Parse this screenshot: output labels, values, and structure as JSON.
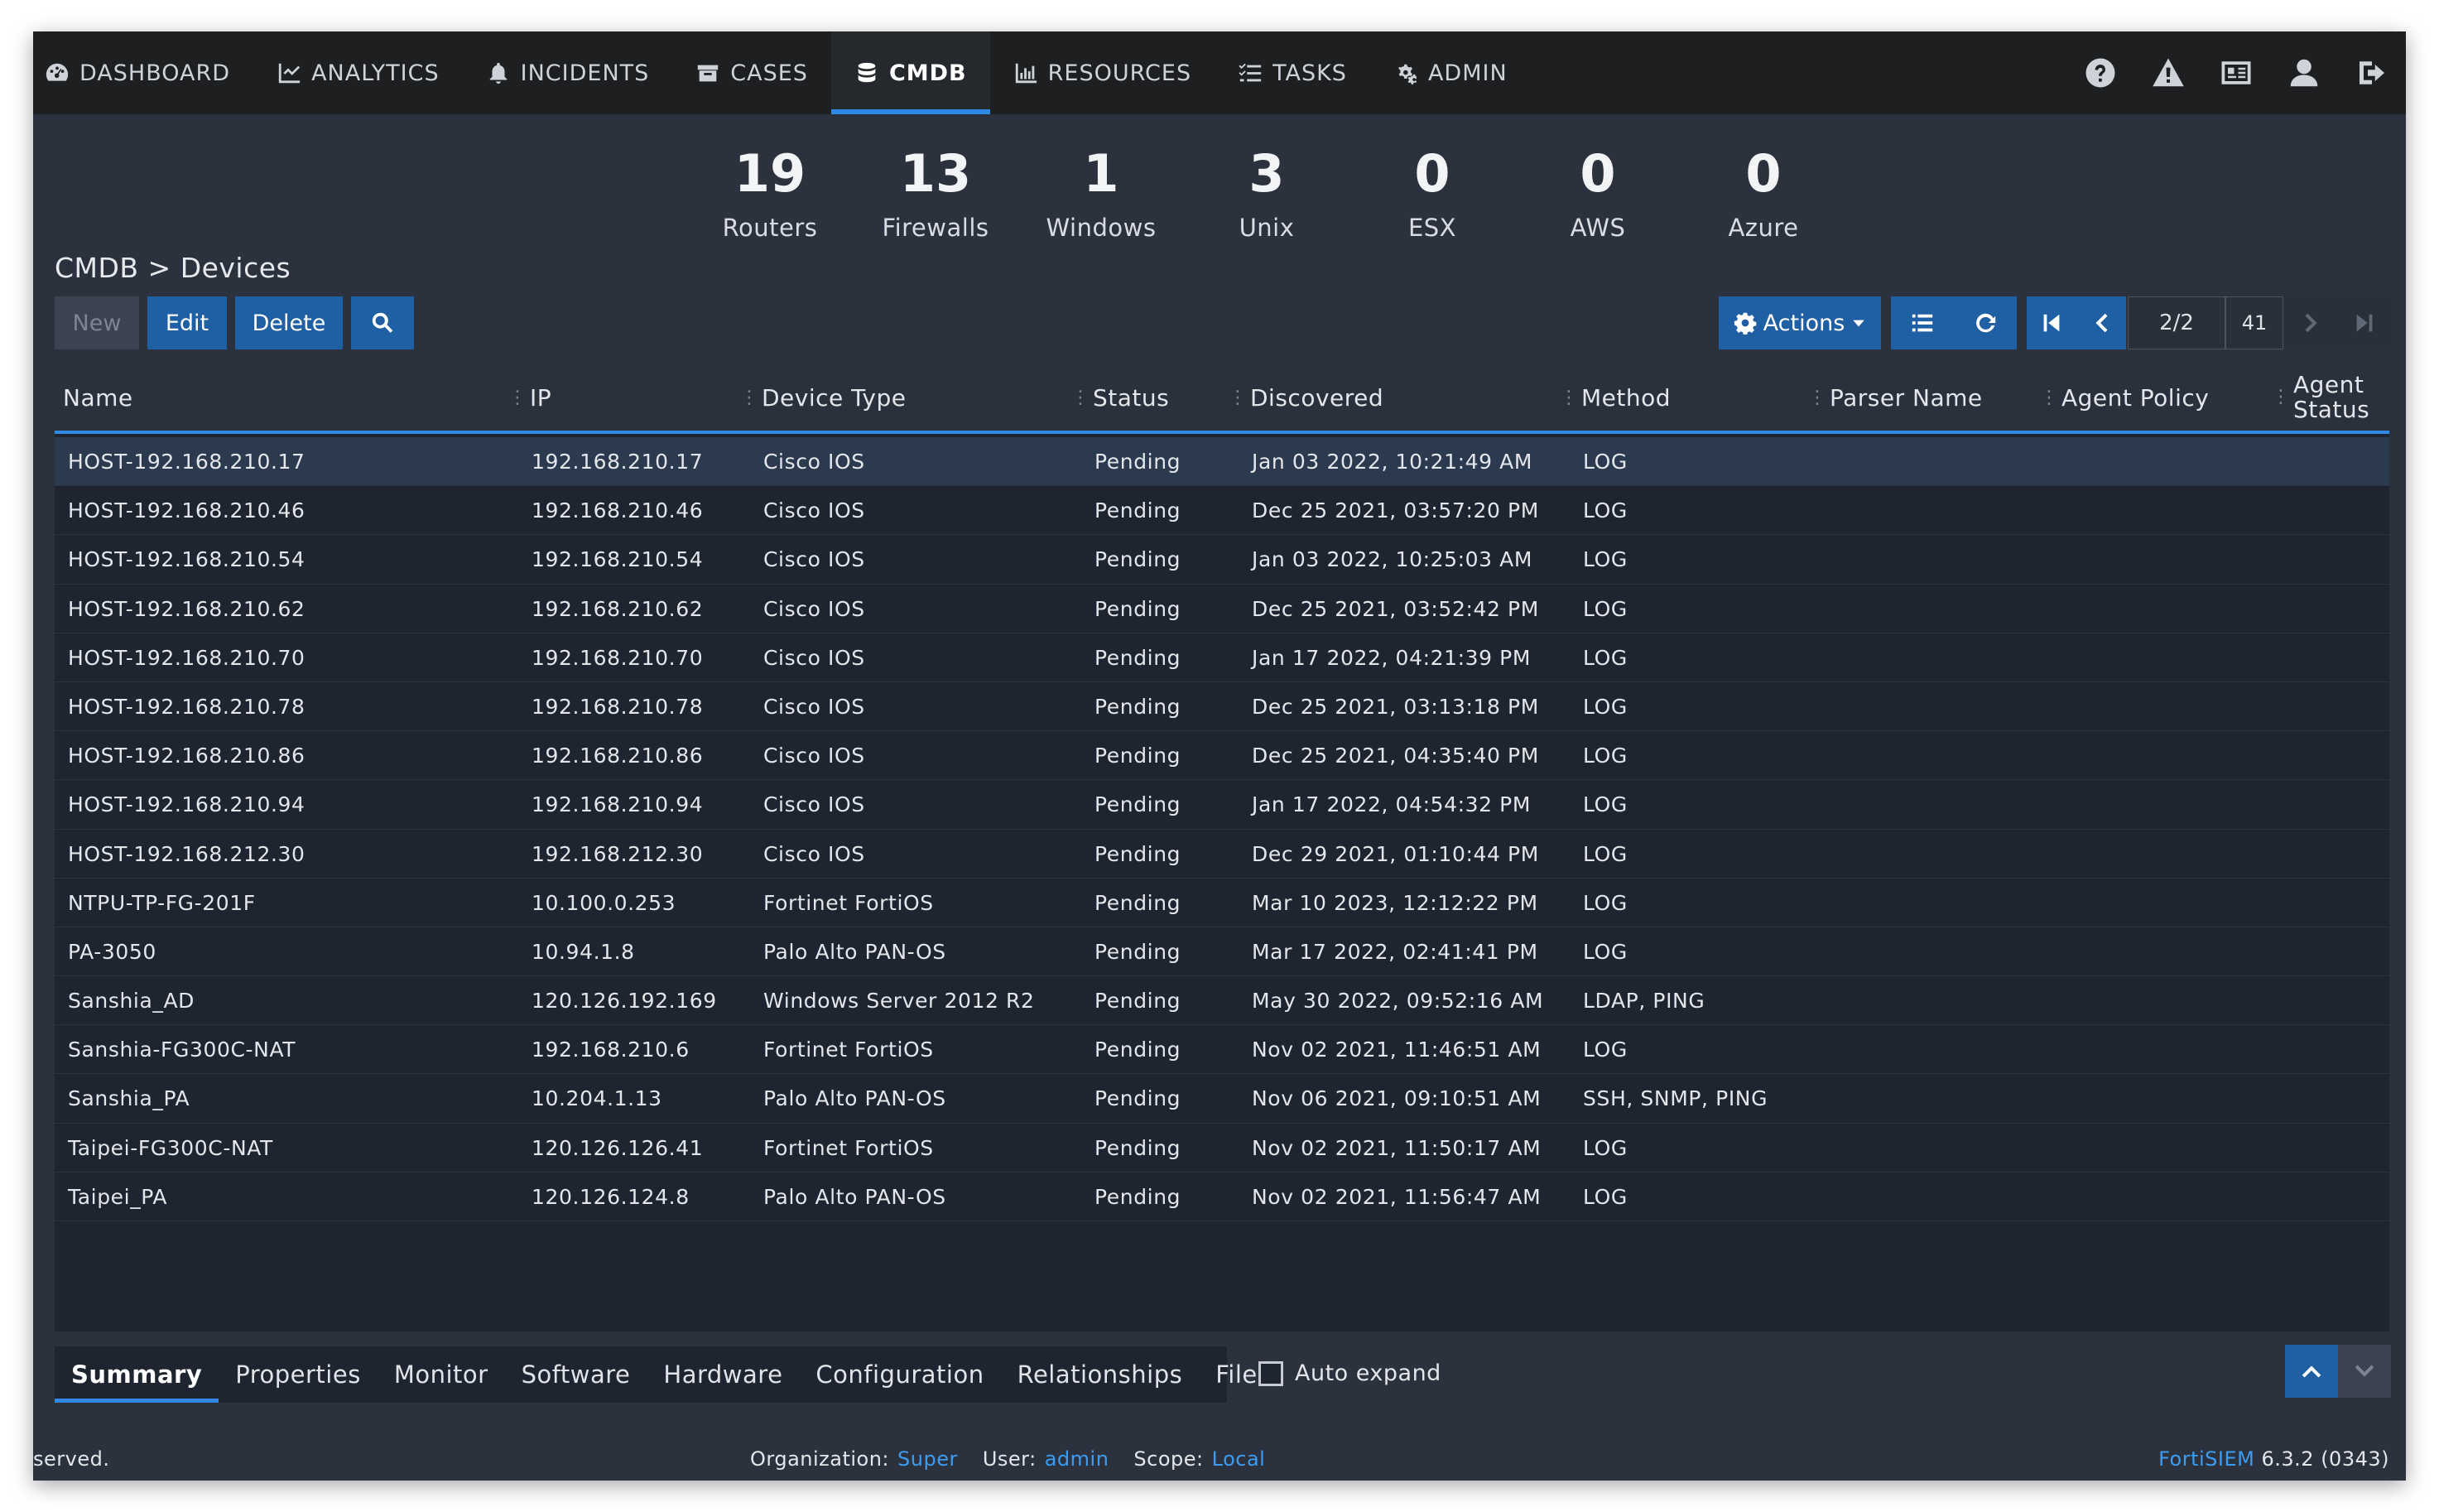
{
  "nav": {
    "items": [
      {
        "label": "DASHBOARD",
        "icon": "dashboard-icon"
      },
      {
        "label": "ANALYTICS",
        "icon": "chart-icon"
      },
      {
        "label": "INCIDENTS",
        "icon": "bell-icon"
      },
      {
        "label": "CASES",
        "icon": "inbox-icon"
      },
      {
        "label": "CMDB",
        "icon": "database-icon"
      },
      {
        "label": "RESOURCES",
        "icon": "bar-chart-icon"
      },
      {
        "label": "TASKS",
        "icon": "list-icon"
      },
      {
        "label": "ADMIN",
        "icon": "gears-icon"
      }
    ],
    "active": "CMDB",
    "right_icons": [
      "help-icon",
      "warning-icon",
      "id-card-icon",
      "user-icon",
      "logout-icon"
    ]
  },
  "stats": [
    {
      "count": "19",
      "label": "Routers"
    },
    {
      "count": "13",
      "label": "Firewalls"
    },
    {
      "count": "1",
      "label": "Windows"
    },
    {
      "count": "3",
      "label": "Unix"
    },
    {
      "count": "0",
      "label": "ESX"
    },
    {
      "count": "0",
      "label": "AWS"
    },
    {
      "count": "0",
      "label": "Azure"
    }
  ],
  "breadcrumb": "CMDB > Devices",
  "toolbar": {
    "new_label": "New",
    "edit_label": "Edit",
    "delete_label": "Delete",
    "actions_label": "Actions",
    "page": "2/2",
    "total": "41"
  },
  "table": {
    "columns": [
      "Name",
      "IP",
      "Device Type",
      "Status",
      "Discovered",
      "Method",
      "Parser Name",
      "Agent Policy",
      "Agent",
      "Status"
    ],
    "rows": [
      [
        "HOST-192.168.210.17",
        "192.168.210.17",
        "Cisco IOS",
        "Pending",
        "Jan 03 2022, 10:21:49 AM",
        "LOG"
      ],
      [
        "HOST-192.168.210.46",
        "192.168.210.46",
        "Cisco IOS",
        "Pending",
        "Dec 25 2021, 03:57:20 PM",
        "LOG"
      ],
      [
        "HOST-192.168.210.54",
        "192.168.210.54",
        "Cisco IOS",
        "Pending",
        "Jan 03 2022, 10:25:03 AM",
        "LOG"
      ],
      [
        "HOST-192.168.210.62",
        "192.168.210.62",
        "Cisco IOS",
        "Pending",
        "Dec 25 2021, 03:52:42 PM",
        "LOG"
      ],
      [
        "HOST-192.168.210.70",
        "192.168.210.70",
        "Cisco IOS",
        "Pending",
        "Jan 17 2022, 04:21:39 PM",
        "LOG"
      ],
      [
        "HOST-192.168.210.78",
        "192.168.210.78",
        "Cisco IOS",
        "Pending",
        "Dec 25 2021, 03:13:18 PM",
        "LOG"
      ],
      [
        "HOST-192.168.210.86",
        "192.168.210.86",
        "Cisco IOS",
        "Pending",
        "Dec 25 2021, 04:35:40 PM",
        "LOG"
      ],
      [
        "HOST-192.168.210.94",
        "192.168.210.94",
        "Cisco IOS",
        "Pending",
        "Jan 17 2022, 04:54:32 PM",
        "LOG"
      ],
      [
        "HOST-192.168.212.30",
        "192.168.212.30",
        "Cisco IOS",
        "Pending",
        "Dec 29 2021, 01:10:44 PM",
        "LOG"
      ],
      [
        "NTPU-TP-FG-201F",
        "10.100.0.253",
        "Fortinet FortiOS",
        "Pending",
        "Mar 10 2023, 12:12:22 PM",
        "LOG"
      ],
      [
        "PA-3050",
        "10.94.1.8",
        "Palo Alto PAN-OS",
        "Pending",
        "Mar 17 2022, 02:41:41 PM",
        "LOG"
      ],
      [
        "Sanshia_AD",
        "120.126.192.169",
        "Windows Server 2012 R2",
        "Pending",
        "May 30 2022, 09:52:16 AM",
        "LDAP, PING"
      ],
      [
        "Sanshia-FG300C-NAT",
        "192.168.210.6",
        "Fortinet FortiOS",
        "Pending",
        "Nov 02 2021, 11:46:51 AM",
        "LOG"
      ],
      [
        "Sanshia_PA",
        "10.204.1.13",
        "Palo Alto PAN-OS",
        "Pending",
        "Nov 06 2021, 09:10:51 AM",
        "SSH, SNMP, PING"
      ],
      [
        "Taipei-FG300C-NAT",
        "120.126.126.41",
        "Fortinet FortiOS",
        "Pending",
        "Nov 02 2021, 11:50:17 AM",
        "LOG"
      ],
      [
        "Taipei_PA",
        "120.126.124.8",
        "Palo Alto PAN-OS",
        "Pending",
        "Nov 02 2021, 11:56:47 AM",
        "LOG"
      ]
    ]
  },
  "detail_tabs": [
    "Summary",
    "Properties",
    "Monitor",
    "Software",
    "Hardware",
    "Configuration",
    "Relationships",
    "File"
  ],
  "active_detail_tab": "Summary",
  "auto_expand_label": "Auto expand",
  "footer": {
    "left": "served.",
    "org_label": "Organization:",
    "org_value": "Super",
    "user_label": "User:",
    "user_value": "admin",
    "scope_label": "Scope:",
    "scope_value": "Local",
    "brand": "FortiSIEM",
    "version": "6.3.2 (0343)"
  },
  "colors": {
    "accent": "#2f8ae6",
    "button": "#1f5fa3",
    "nav_bg": "#1e1f21",
    "panel_bg": "#2c323d",
    "table_bg": "#1f2530",
    "selected_row": "#2c3a4f"
  }
}
